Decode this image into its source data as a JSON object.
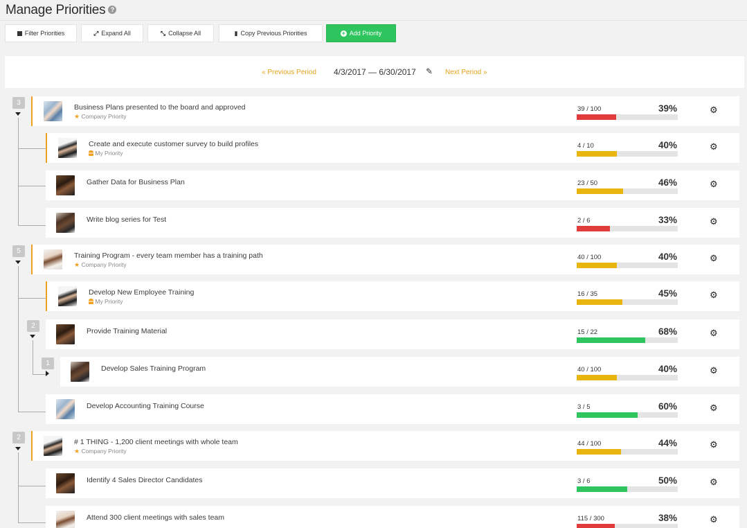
{
  "page": {
    "title": "Manage Priorities",
    "help_glyph": "?"
  },
  "toolbar": {
    "filter_label": "Filter Priorities",
    "expand_label": "Expand All",
    "collapse_label": "Collapse All",
    "copy_label": "Copy Previous Priorities",
    "add_label": "Add Priority"
  },
  "period": {
    "prev_label": "« Previous Period",
    "range": "4/3/2017 — 6/30/2017",
    "next_label": "Next Period »"
  },
  "colors": {
    "accent_orange": "#f0a020",
    "add_green": "#2ec45e",
    "bar_red": "#e23b3b",
    "bar_yellow": "#e8b50e",
    "bar_green": "#2ec45e",
    "bar_track": "#e4e4e4"
  },
  "icons": {
    "gear": "⚙",
    "edit": "✎",
    "star": "★",
    "person": "👤"
  },
  "priorities": [
    {
      "title": "Business Plans presented to the board and approved",
      "tag": "Company Priority",
      "tag_icon": "star",
      "progress": "39 / 100",
      "percent": "39%",
      "fraction": 0.39,
      "bar_color": "red",
      "group_count": "3"
    },
    {
      "title": "Create and execute customer survey to build profiles",
      "tag": "My Priority",
      "tag_icon": "person",
      "progress": "4 / 10",
      "percent": "40%",
      "fraction": 0.4,
      "bar_color": "yellow"
    },
    {
      "title": "Gather Data for Business Plan",
      "progress": "23 / 50",
      "percent": "46%",
      "fraction": 0.46,
      "bar_color": "yellow"
    },
    {
      "title": "Write blog series for Test",
      "progress": "2 / 6",
      "percent": "33%",
      "fraction": 0.33,
      "bar_color": "red"
    },
    {
      "title": "Training Program - every team member has a training path",
      "tag": "Company Priority",
      "tag_icon": "star",
      "progress": "40 / 100",
      "percent": "40%",
      "fraction": 0.4,
      "bar_color": "yellow",
      "group_count": "5"
    },
    {
      "title": "Develop New Employee Training",
      "tag": "My Priority",
      "tag_icon": "person",
      "progress": "16 / 35",
      "percent": "45%",
      "fraction": 0.45,
      "bar_color": "yellow"
    },
    {
      "title": "Provide Training Material",
      "progress": "15 / 22",
      "percent": "68%",
      "fraction": 0.68,
      "bar_color": "green",
      "group_count": "2"
    },
    {
      "title": "Develop Sales Training Program",
      "progress": "40 / 100",
      "percent": "40%",
      "fraction": 0.4,
      "bar_color": "yellow",
      "group_count": "1"
    },
    {
      "title": "Develop Accounting Training Course",
      "progress": "3 / 5",
      "percent": "60%",
      "fraction": 0.6,
      "bar_color": "green"
    },
    {
      "title": "# 1 THING - 1,200 client meetings with whole team",
      "tag": "Company Priority",
      "tag_icon": "star",
      "progress": "44 / 100",
      "percent": "44%",
      "fraction": 0.44,
      "bar_color": "yellow",
      "group_count": "2"
    },
    {
      "title": "Identify 4 Sales Director Candidates",
      "progress": "3 / 6",
      "percent": "50%",
      "fraction": 0.5,
      "bar_color": "green"
    },
    {
      "title": "Attend 300 client meetings with sales team",
      "progress": "115 / 300",
      "percent": "38%",
      "fraction": 0.38,
      "bar_color": "red"
    }
  ]
}
